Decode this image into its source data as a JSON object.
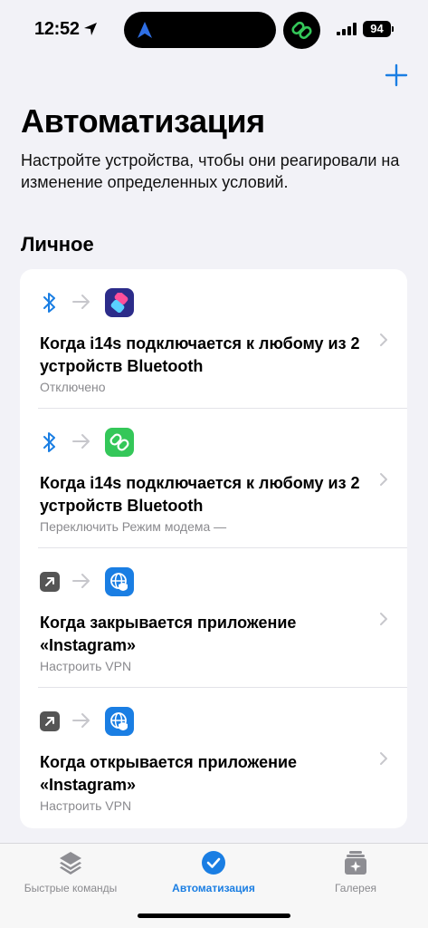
{
  "status_bar": {
    "time": "12:52",
    "battery": "94"
  },
  "header": {
    "title": "Автоматизация",
    "subtitle": "Настройте устройства, чтобы они реагировали на изменение определенных условий.",
    "section": "Личное"
  },
  "automations": [
    {
      "trigger_icon": "bluetooth-icon",
      "action_icon": "shortcuts-icon",
      "title": "Когда i14s подключается к любому из 2 устройств Bluetooth",
      "subtitle": "Отключено"
    },
    {
      "trigger_icon": "bluetooth-icon",
      "action_icon": "hotspot-icon",
      "title": "Когда i14s подключается к любому из 2 устройств Bluetooth",
      "subtitle": "Переключить Режим модема —"
    },
    {
      "trigger_icon": "app-close-icon",
      "action_icon": "vpn-icon",
      "title": "Когда закрывается приложение «Instagram»",
      "subtitle": "Настроить VPN"
    },
    {
      "trigger_icon": "app-open-icon",
      "action_icon": "vpn-icon",
      "title": "Когда открывается приложение «Instagram»",
      "subtitle": "Настроить VPN"
    }
  ],
  "tab_bar": {
    "tabs": [
      {
        "label": "Быстрые команды",
        "icon": "layers-icon"
      },
      {
        "label": "Автоматизация",
        "icon": "clock-check-icon"
      },
      {
        "label": "Галерея",
        "icon": "gallery-icon"
      }
    ],
    "active": 1
  },
  "colors": {
    "accent": "#1a7ee3",
    "hotspot_green": "#34c759",
    "shortcuts_bg": "#2c2c8a",
    "vpn_blue": "#1a7ee3"
  }
}
